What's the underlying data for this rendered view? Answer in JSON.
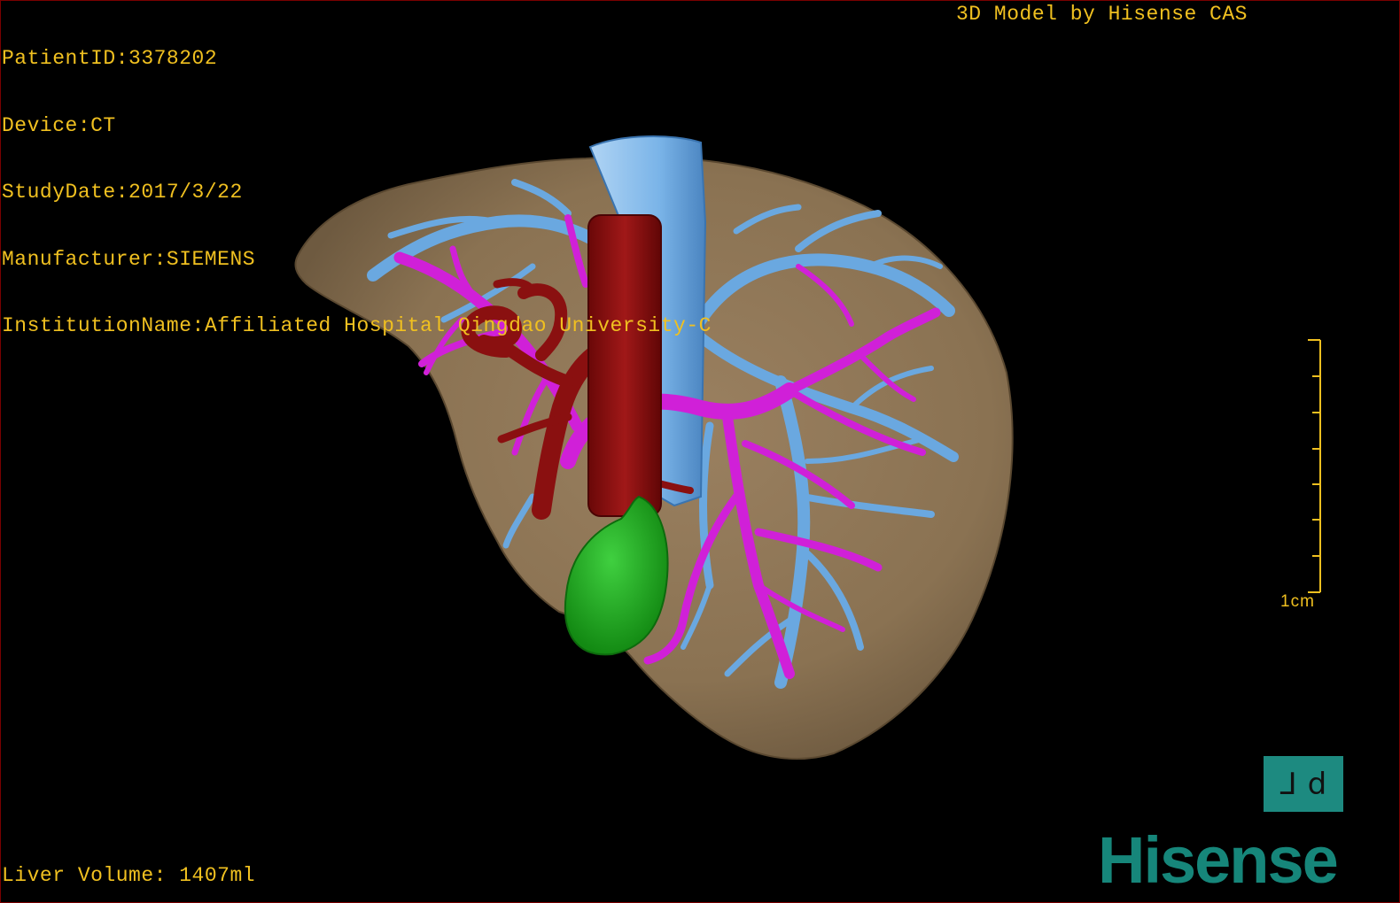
{
  "overlay": {
    "patient_id": "PatientID:3378202",
    "device": "Device:CT",
    "study_date": "StudyDate:2017/3/22",
    "manufacturer": "Manufacturer:SIEMENS",
    "institution": "InstitutionName:Affiliated Hospital Qingdao University-C",
    "model_credit": "3D Model by Hisense CAS",
    "liver_volume": "Liver Volume: 1407ml"
  },
  "scale": {
    "label": "1cm"
  },
  "view_toggle": {
    "left_glyph": "⅃",
    "right_glyph": "d"
  },
  "brand": {
    "logo_text": "Hisense"
  },
  "colors": {
    "overlay_text": "#f0c020",
    "liver": "#8a7252",
    "hepatic_vein": "#6aa8e0",
    "portal_vein": "#d020d8",
    "artery_ivc": "#8a1010",
    "gallbladder": "#22a822",
    "brand": "#16867a"
  }
}
